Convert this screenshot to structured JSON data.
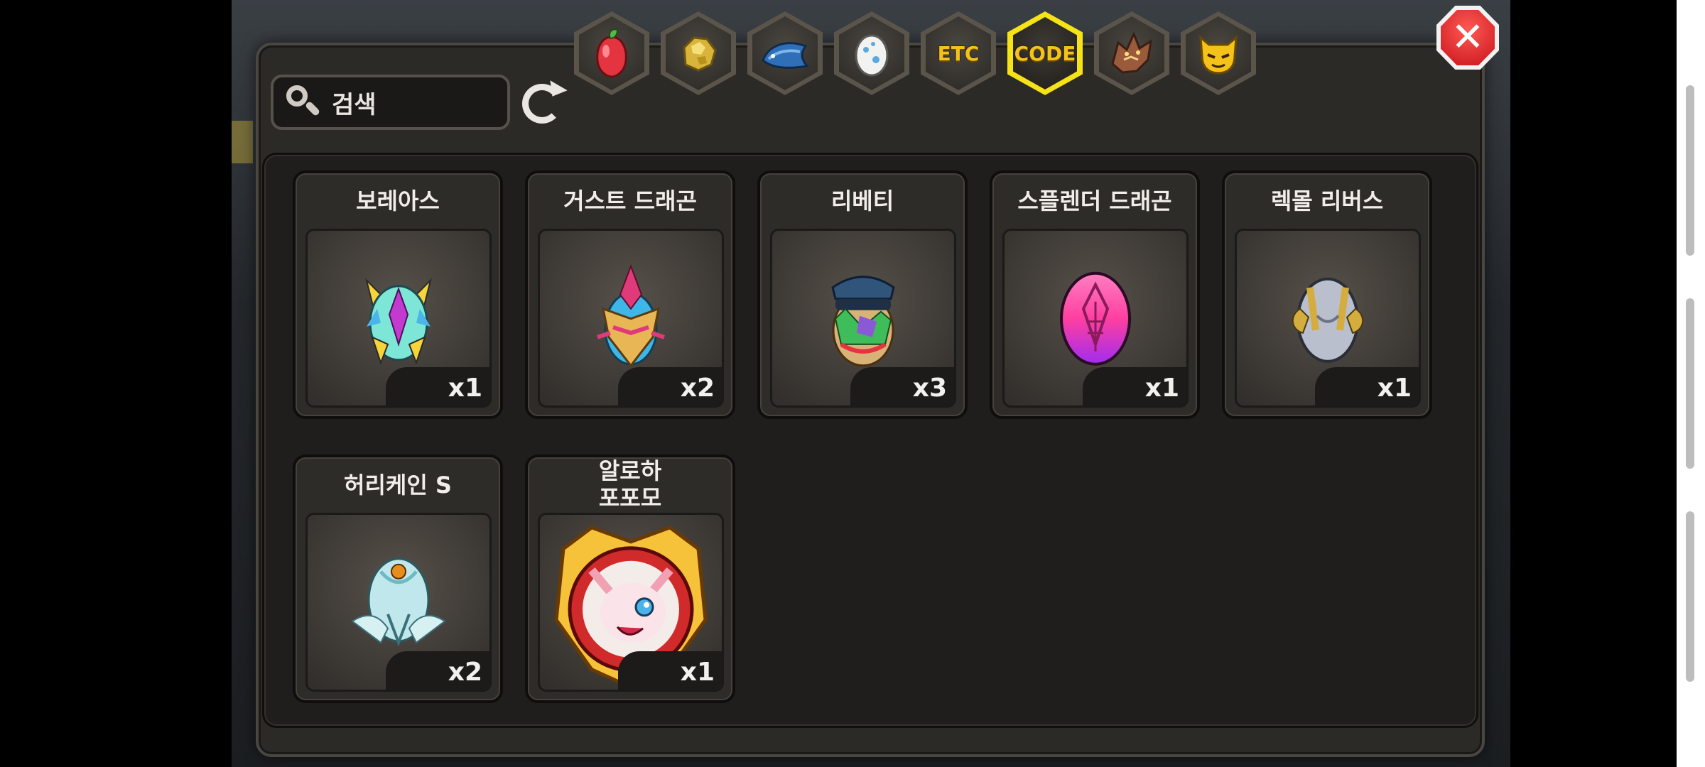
{
  "search": {
    "placeholder": "검색"
  },
  "tabs": [
    {
      "icon": "fruit-icon",
      "active": false
    },
    {
      "icon": "gold-nugget-icon",
      "active": false
    },
    {
      "icon": "fish-icon",
      "active": false
    },
    {
      "icon": "egg-icon",
      "active": false
    },
    {
      "label": "ETC",
      "active": false
    },
    {
      "label": "CODE",
      "active": true
    },
    {
      "icon": "dragon-head-icon",
      "active": false
    },
    {
      "icon": "monster-face-icon",
      "active": false
    }
  ],
  "items": [
    {
      "name": "보레아스",
      "qty": "x1",
      "icon": "boreas-egg-icon",
      "colors": [
        "#7ee6d6",
        "#c33ad0",
        "#f6d43a"
      ]
    },
    {
      "name": "거스트 드래곤",
      "qty": "x2",
      "icon": "gust-dragon-egg-icon",
      "colors": [
        "#3fb6e8",
        "#e03a7b",
        "#e9b656"
      ]
    },
    {
      "name": "리베티",
      "qty": "x3",
      "icon": "libety-egg-icon",
      "colors": [
        "#31557a",
        "#3fbd5a",
        "#d9b277"
      ]
    },
    {
      "name": "스플렌더 드래곤",
      "qty": "x1",
      "icon": "splendor-dragon-egg-icon",
      "colors": [
        "#ff3fa0",
        "#a02cf0",
        "#ff8fd0"
      ]
    },
    {
      "name": "렉몰 리버스",
      "qty": "x1",
      "icon": "rekmol-reverse-egg-icon",
      "colors": [
        "#b9bfcc",
        "#d4ad3e",
        "#6c7285"
      ]
    },
    {
      "name": "허리케인 S",
      "qty": "x2",
      "icon": "hurricane-s-egg-icon",
      "colors": [
        "#bfe7ec",
        "#6fb9c2",
        "#e78d1e"
      ]
    },
    {
      "name_line1": "알로하",
      "name_line2": "포포모",
      "qty": "x1",
      "icon": "aloha-popomo-portrait-icon",
      "colors": [
        "#d02a2a",
        "#f5c23a",
        "#ffffff"
      ]
    }
  ]
}
